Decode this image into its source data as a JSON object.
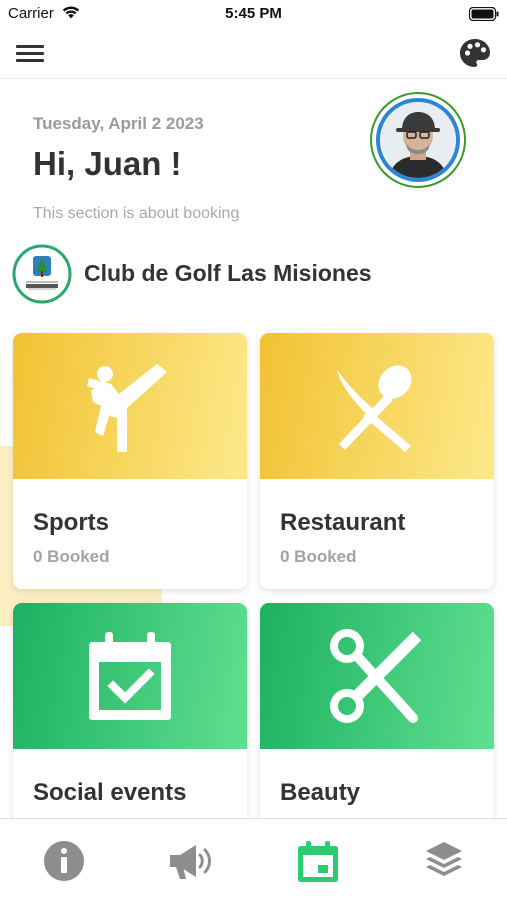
{
  "status_bar": {
    "carrier": "Carrier",
    "time": "5:45 PM"
  },
  "nav": {
    "menu_icon": "hamburger-icon",
    "theme_icon": "palette-icon"
  },
  "header": {
    "date": "Tuesday, April 2 2023",
    "greeting": "Hi, Juan !",
    "description": "This section is about booking"
  },
  "club": {
    "name": "Club de Golf Las Misiones"
  },
  "cards": [
    {
      "title": "Sports",
      "booked": "0 Booked",
      "icon": "martial-arts-kick-icon"
    },
    {
      "title": "Restaurant",
      "booked": "0 Booked",
      "icon": "knife-spoon-icon"
    },
    {
      "title": "Social events",
      "booked": "",
      "icon": "calendar-check-icon"
    },
    {
      "title": "Beauty",
      "booked": "",
      "icon": "scissors-icon"
    }
  ],
  "tabs": [
    {
      "icon": "info-icon",
      "active": false
    },
    {
      "icon": "megaphone-icon",
      "active": false
    },
    {
      "icon": "calendar-icon",
      "active": true
    },
    {
      "icon": "layers-icon",
      "active": false
    }
  ],
  "colors": {
    "yellow_start": "#f1c232",
    "yellow_end": "#fde98a",
    "green_start": "#1db062",
    "green_end": "#5fe08f",
    "tab_active": "#2ecc71",
    "tab_inactive": "#8d8d8d"
  }
}
